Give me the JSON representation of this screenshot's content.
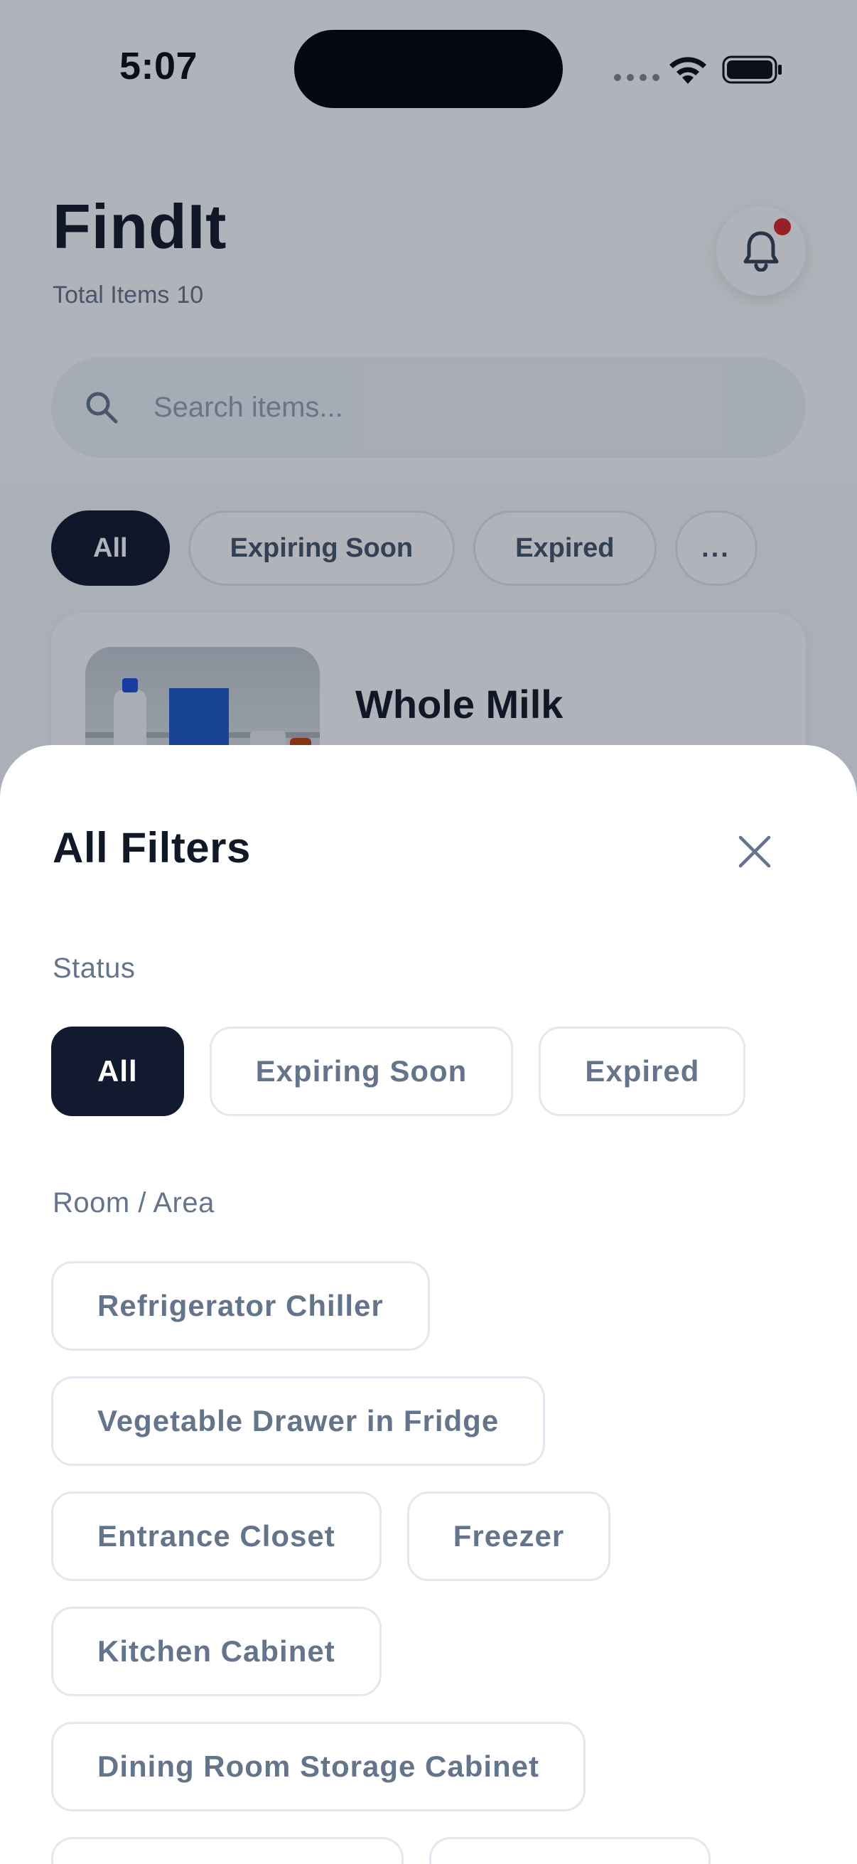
{
  "status_bar": {
    "time": "5:07"
  },
  "header": {
    "title": "FindIt",
    "total_items_label": "Total Items",
    "total_items_count": "10"
  },
  "search": {
    "placeholder": "Search items...",
    "value": ""
  },
  "quick_filters": [
    {
      "label": "All",
      "active": true
    },
    {
      "label": "Expiring Soon",
      "active": false
    },
    {
      "label": "Expired",
      "active": false
    },
    {
      "label": "...",
      "active": false
    }
  ],
  "items": [
    {
      "name": "Whole Milk",
      "image": "refrigerator-shelf-photo"
    }
  ],
  "filters_sheet": {
    "title": "All Filters",
    "status_section": {
      "label": "Status",
      "options": [
        "All",
        "Expiring Soon",
        "Expired"
      ],
      "selected": "All"
    },
    "room_section": {
      "label": "Room / Area",
      "options": [
        "Refrigerator Chiller",
        "Vegetable Drawer in Fridge",
        "Entrance Closet",
        "Freezer",
        "Kitchen Cabinet",
        "Dining Room Storage Cabinet"
      ]
    }
  },
  "icons": {
    "search": "search-icon",
    "bell": "bell-icon",
    "close": "close-icon",
    "wifi": "wifi-icon",
    "battery": "battery-icon"
  },
  "colors": {
    "primary_dark": "#111a2e",
    "notification": "#dc2626",
    "chip_border": "#e2e8f0",
    "muted_text": "#64748b"
  }
}
